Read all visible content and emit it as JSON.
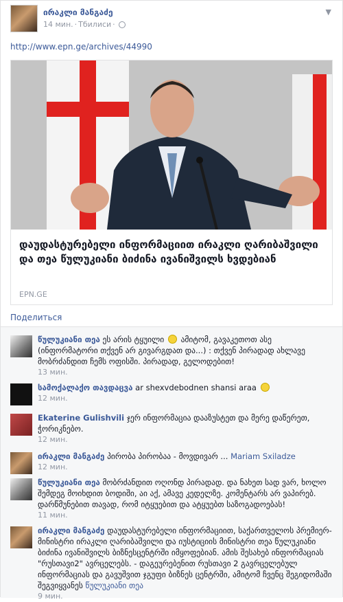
{
  "post": {
    "author": "ირაკლი მანგაძე",
    "time": "14 мин.",
    "separator": "·",
    "location": "Тбилиси",
    "separator2": "·",
    "menu_icon": "chevron-down-icon",
    "url": "http://www.epn.ge/archives/44990",
    "card": {
      "title": "დაუდასტურებელი ინფორმაციით ირაკლი ღარიბაშვილი და თეა წულუკიანი ბიძინა ივანიშვილს ხვდებიან",
      "source": "EPN.GE"
    },
    "share_label": "Поделиться"
  },
  "comments": [
    {
      "name": "წულუკიანი თეა",
      "text_before": "ეს არის ტყუილი",
      "emoji": "smiley-icon",
      "text_after": "ამიტომ, გავაკეთოთ ასე (ინფორმატორი თქვენ არ გივარგდათ და...) : თქვენ პირადად ახლავე მობრძანდით ჩემს ოფისში. პირადად, გელოდებით!",
      "time": "13 мин."
    },
    {
      "name": "სამოქალაქო თავდაცვა",
      "text_before": "ar shexvdebodnen shansi araa",
      "emoji": "smiley-icon",
      "text_after": "",
      "time": "12 мин."
    },
    {
      "name": "Ekaterine Gulishvili",
      "text_before": "ჯერ ინფორმაცია დააზუსტეთ და მერე დაწერეთ, ჭორიკნებო.",
      "text_after": "",
      "time": "12 мин."
    },
    {
      "name": "ირაკლი მანგაძე",
      "text_before": "პირობა პირობაა - მოვდივარ ...",
      "mention": "Mariam Sxiladze",
      "text_after": "",
      "time": "12 мин."
    },
    {
      "name": "წულუკიანი თეა",
      "text_before": "მობრძანდით ოღონდ პირადად. და ნახეთ სად ვარ, ხოლო შემდეგ მოიხდით ბოდიში, აი აქ, ამავე კედელზე. კომენტარს არ ვაპირებ. დარწმუნებით თავად, რომ იტყუებით და ატყუებთ საზოგადოებას!",
      "text_after": "",
      "time": "11 мин."
    },
    {
      "name": "ირაკლი მანგაძე",
      "text_before": "დაუდასტურებელი ინფორმაციით, საქართველოს პრემიერ-მინისტრი ირაკლი ღარიბაშვილი და იუსტიციის მინისტრი თეა წულუკიანი ბიძინა ივანიშვილს ბიზნესცენტრში იმყოფებიან. ამის შესახებ ინფორმაციას \"რუსთავი2\" ავრცელებს. - დაგეურებენით რუსთავი 2 გავრცელებულ ინფორმაციას და გავუშვით ჯგუფი ბიზნეს ცენტრში, ამიტომ ჩვენც შეგიდომაში შეგვიყვანეს",
      "mention": "წულუკიანი თეა",
      "text_after": "",
      "time": "9 мин."
    }
  ],
  "colors": {
    "link": "#3b5998",
    "muted": "#9197a3",
    "flag_red": "#e0221f"
  }
}
